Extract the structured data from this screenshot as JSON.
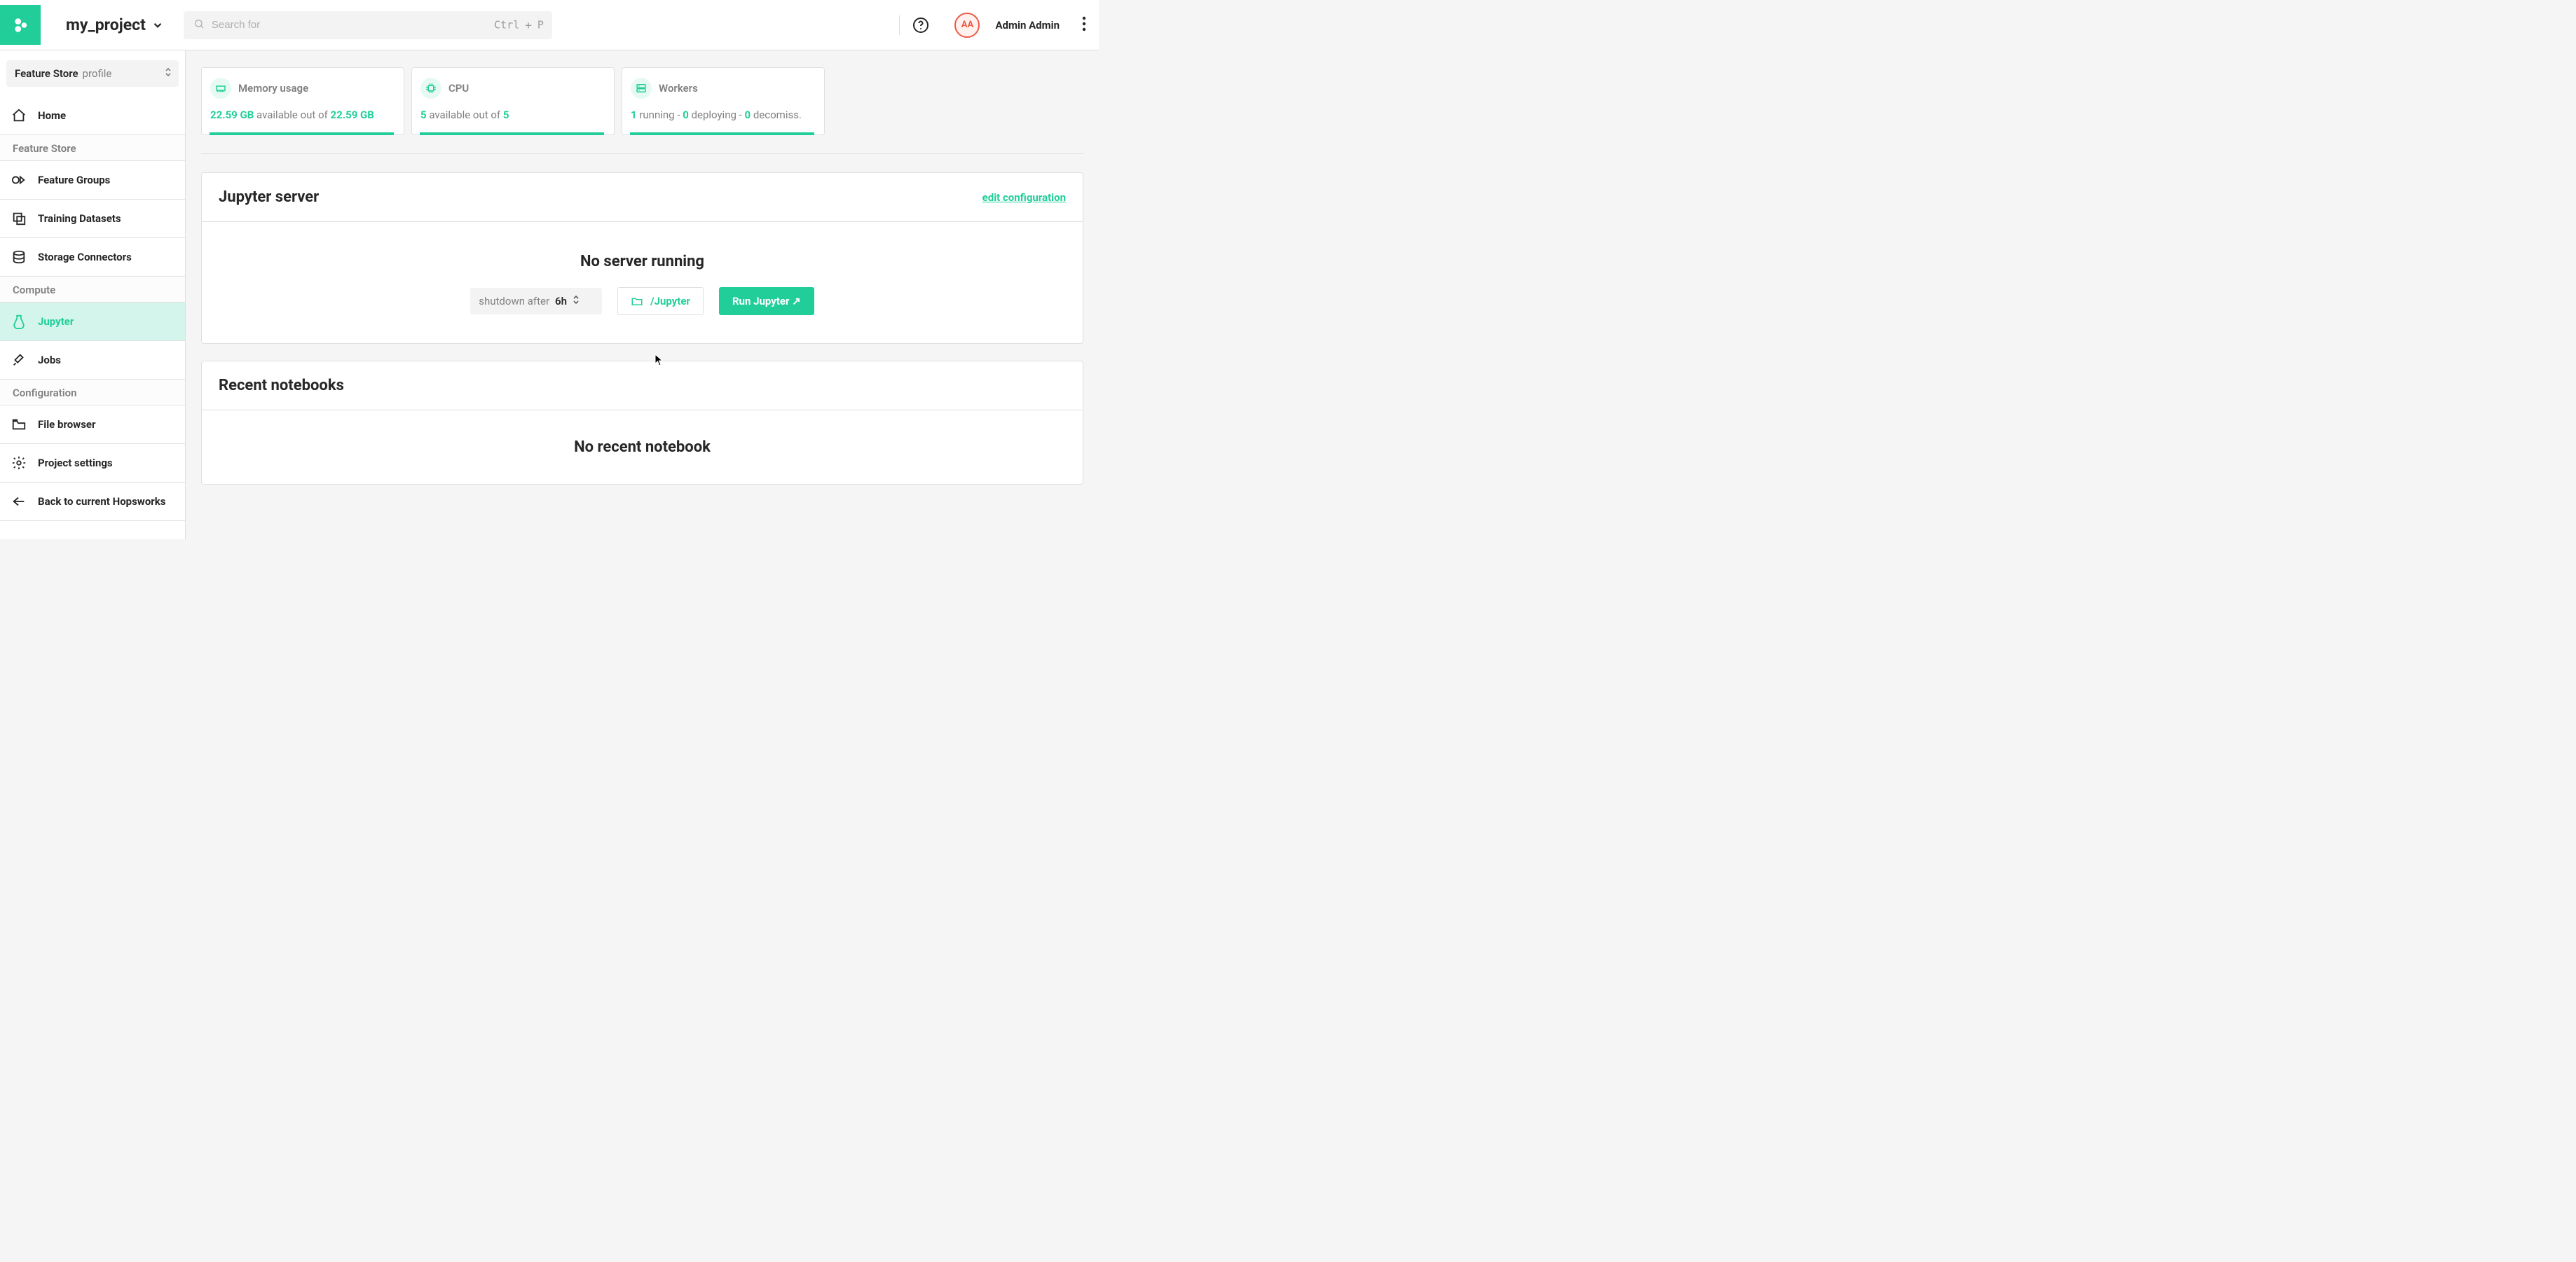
{
  "topbar": {
    "project_name": "my_project",
    "search_placeholder": "Search for",
    "shortcut_key1": "Ctrl",
    "shortcut_plus": "+",
    "shortcut_key2": "P",
    "avatar_initials": "AA",
    "user_display": "Admin Admin"
  },
  "sidebar": {
    "profile_label": "Feature Store",
    "profile_value": "profile",
    "home": "Home",
    "section_fs": "Feature Store",
    "feature_groups": "Feature Groups",
    "training_datasets": "Training Datasets",
    "storage_connectors": "Storage Connectors",
    "section_compute": "Compute",
    "jupyter": "Jupyter",
    "jobs": "Jobs",
    "section_config": "Configuration",
    "file_browser": "File browser",
    "project_settings": "Project settings",
    "back": "Back to current Hopsworks"
  },
  "stats": {
    "memory": {
      "title": "Memory usage",
      "avail": "22.59 GB",
      "mid": " available out of ",
      "total": "22.59 GB"
    },
    "cpu": {
      "title": "CPU",
      "avail": "5",
      "mid": " available out of ",
      "total": "5"
    },
    "workers": {
      "title": "Workers",
      "running_n": "1",
      "running_t": " running",
      "sep": " - ",
      "deploying_n": "0",
      "deploying_t": " deploying",
      "decomiss_n": "0",
      "decomiss_t": " decomiss."
    }
  },
  "jupyter": {
    "heading": "Jupyter server",
    "edit_link": "edit configuration",
    "empty": "No server running",
    "shutdown_label": "shutdown after",
    "shutdown_value": "6h",
    "folder_btn": "/Jupyter",
    "run_btn": "Run Jupyter ↗"
  },
  "recent": {
    "heading": "Recent notebooks",
    "empty": "No recent notebook"
  }
}
